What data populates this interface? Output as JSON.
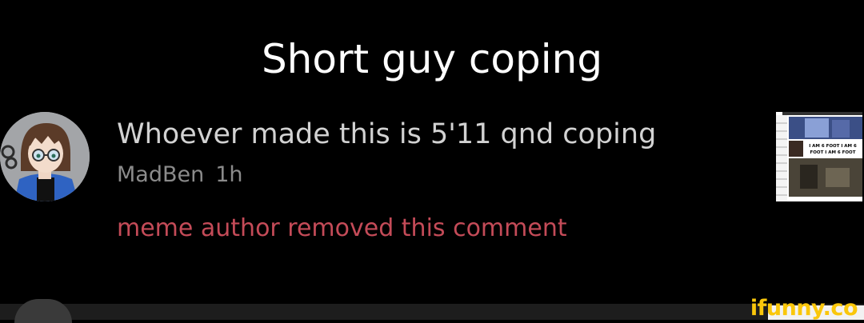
{
  "title": "Short guy coping",
  "comment": {
    "text": "Whoever made this is 5'11 qnd coping",
    "author": "MadBen",
    "time": "1h",
    "reply_status": "meme author removed this comment"
  },
  "thumbnail": {
    "caption_line1": "I AM 6 FOOT I AM 6",
    "caption_line2": "FOOT I AM 6 FOOT"
  },
  "watermark": "ifunny.co",
  "colors": {
    "background": "#000000",
    "title": "#ffffff",
    "comment_text": "#d2d2d2",
    "meta": "#8b8b8b",
    "removed": "#c44b58",
    "watermark": "#fac70b"
  }
}
